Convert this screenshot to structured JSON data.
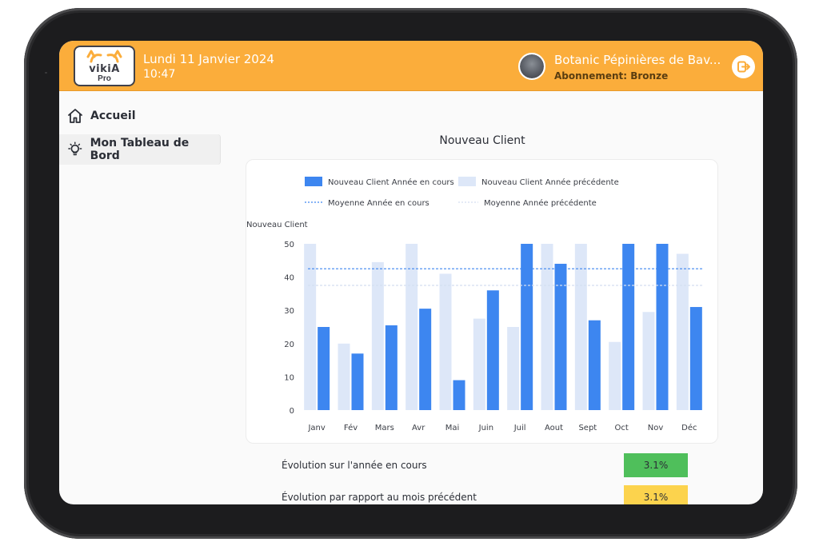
{
  "header": {
    "logo_text": "vikiA",
    "logo_sub": "Pro",
    "date": "Lundi 11 Janvier 2024",
    "time": "10:47",
    "shop_name": "Botanic Pépinières de Bav...",
    "subscription": "Abonnement: Bronze",
    "colors": {
      "bar": "#fbad3b"
    }
  },
  "sidebar": {
    "items": [
      {
        "label": "Accueil",
        "icon": "home-icon"
      },
      {
        "label": "Mon Tableau de Bord",
        "icon": "lightbulb-icon",
        "active": true
      }
    ]
  },
  "chart_title": "Nouveau Client",
  "chart_data": {
    "type": "bar",
    "ylabel": "Nouveau Client",
    "ylim": [
      0,
      50
    ],
    "yticks": [
      0,
      10,
      20,
      30,
      40,
      50
    ],
    "categories": [
      "Janv",
      "Fév",
      "Mars",
      "Avr",
      "Mai",
      "Juin",
      "Juil",
      "Aout",
      "Sept",
      "Oct",
      "Nov",
      "Déc"
    ],
    "series": [
      {
        "name": "Nouveau Client Année précédente",
        "color": "#dde7f8",
        "values": [
          50,
          20,
          44.5,
          50,
          41,
          27.5,
          25,
          50,
          50,
          20.5,
          29.5,
          47
        ]
      },
      {
        "name": "Nouveau Client Année en cours",
        "color": "#3d86f0",
        "values": [
          25,
          17,
          25.5,
          30.5,
          9,
          36,
          50,
          44,
          27,
          50,
          50,
          31
        ]
      }
    ],
    "averages": [
      {
        "name": "Moyenne Année en cours",
        "value": 42.5,
        "color": "#3d86f0"
      },
      {
        "name": "Moyenne Année précédente",
        "value": 37.5,
        "color": "#d4def0"
      }
    ],
    "legend_position": "top",
    "grid": false
  },
  "stats": [
    {
      "label": "Évolution sur l'année en cours",
      "value": "3.1%",
      "color": "#4fbf5b"
    },
    {
      "label": "Évolution par rapport au mois précédent",
      "value": "3.1%",
      "color": "#fcd34d"
    }
  ]
}
